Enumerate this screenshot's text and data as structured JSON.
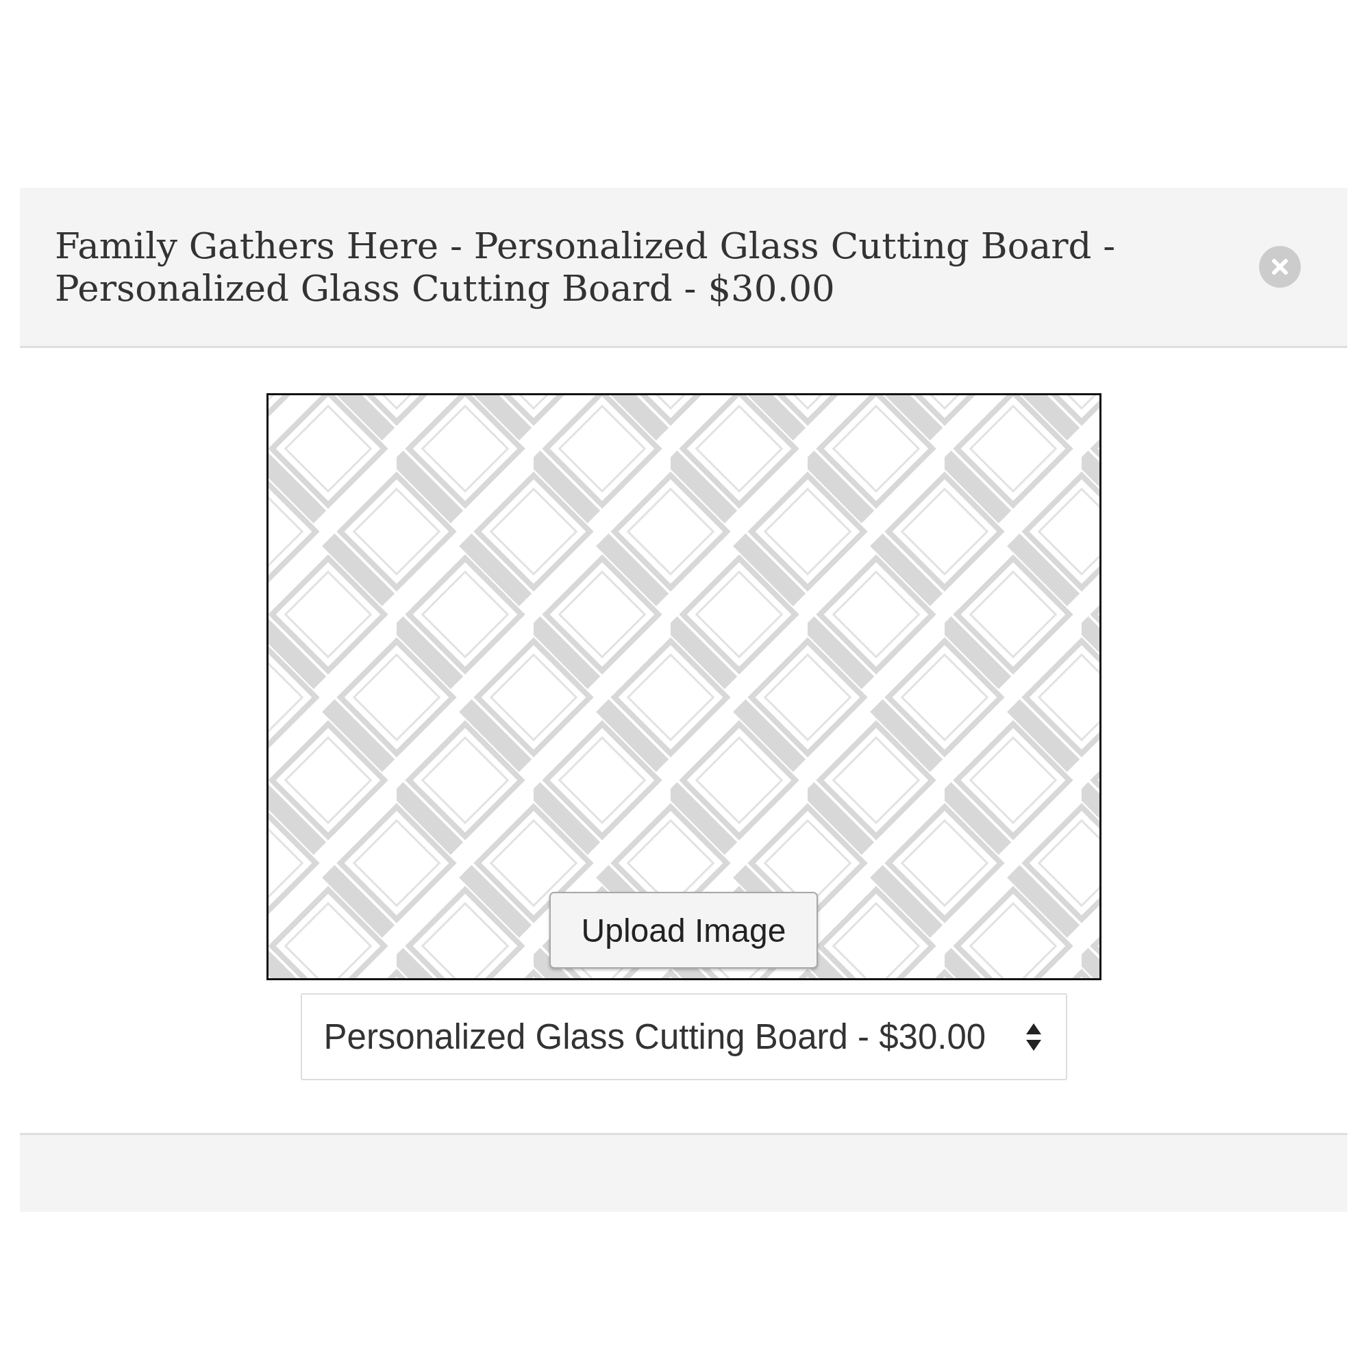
{
  "modal": {
    "title": "Family Gathers Here - Personalized Glass Cutting Board - Personalized Glass Cutting Board - $30.00"
  },
  "preview": {
    "upload_button": "Upload Image"
  },
  "product_select": {
    "value": "Personalized Glass Cutting Board - $30.00"
  }
}
